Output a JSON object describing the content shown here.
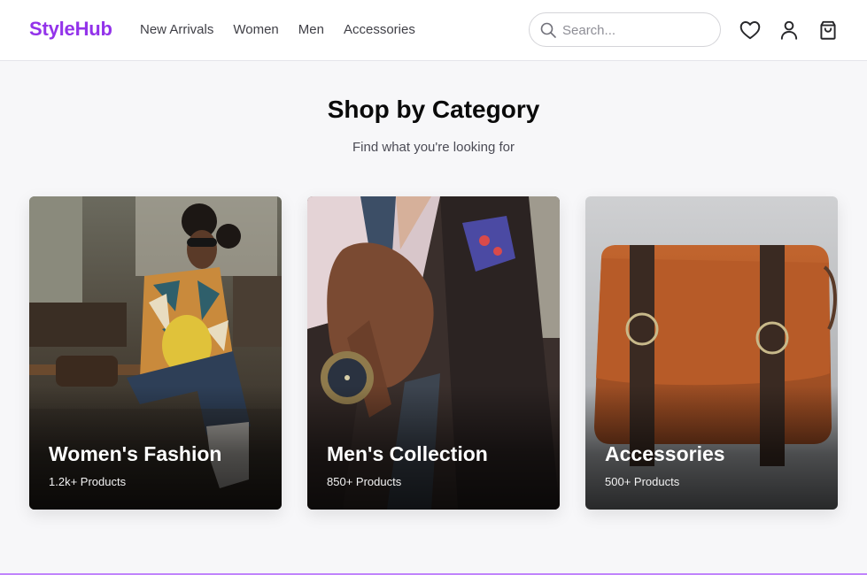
{
  "brand": {
    "name": "StyleHub",
    "color": "#9333ea"
  },
  "nav": {
    "items": [
      "New Arrivals",
      "Women",
      "Men",
      "Accessories"
    ]
  },
  "search": {
    "placeholder": "Search...",
    "value": "",
    "icon": "search-icon"
  },
  "header_icons": [
    "heart-icon",
    "user-icon",
    "shopping-bag-icon"
  ],
  "hero": {
    "title": "Shop by Category",
    "subtitle": "Find what you're looking for"
  },
  "categories": [
    {
      "name": "Women's Fashion",
      "count": "1.2k+ Products"
    },
    {
      "name": "Men's Collection",
      "count": "850+ Products"
    },
    {
      "name": "Accessories",
      "count": "500+ Products"
    }
  ]
}
